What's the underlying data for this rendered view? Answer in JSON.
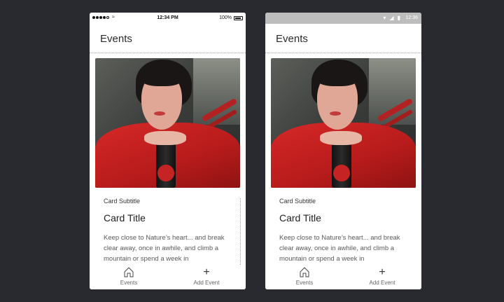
{
  "ios": {
    "status": {
      "time": "12:34 PM",
      "battery": "100%"
    },
    "header": {
      "title": "Events"
    },
    "card": {
      "subtitle": "Card Subtitle",
      "title": "Card Title",
      "text": "Keep close to Nature’s heart... and break clear away, once in awhile, and climb a mountain or spend a week in"
    },
    "tabs": [
      {
        "label": "Events",
        "icon": "home-icon"
      },
      {
        "label": "Add Event",
        "icon": "plus-icon"
      }
    ]
  },
  "android": {
    "status": {
      "time": "12:36"
    },
    "header": {
      "title": "Events"
    },
    "card": {
      "subtitle": "Card Subtitle",
      "title": "Card Title",
      "text": "Keep close to Nature’s heart... and break clear away, once in awhile, and climb a mountain or spend a week in"
    },
    "tabs": [
      {
        "label": "Events",
        "icon": "home-icon"
      },
      {
        "label": "Add Event",
        "icon": "plus-icon"
      }
    ]
  },
  "colors": {
    "background": "#282a30",
    "android_status": "#bdbdbd",
    "shirt": "#d62828"
  }
}
